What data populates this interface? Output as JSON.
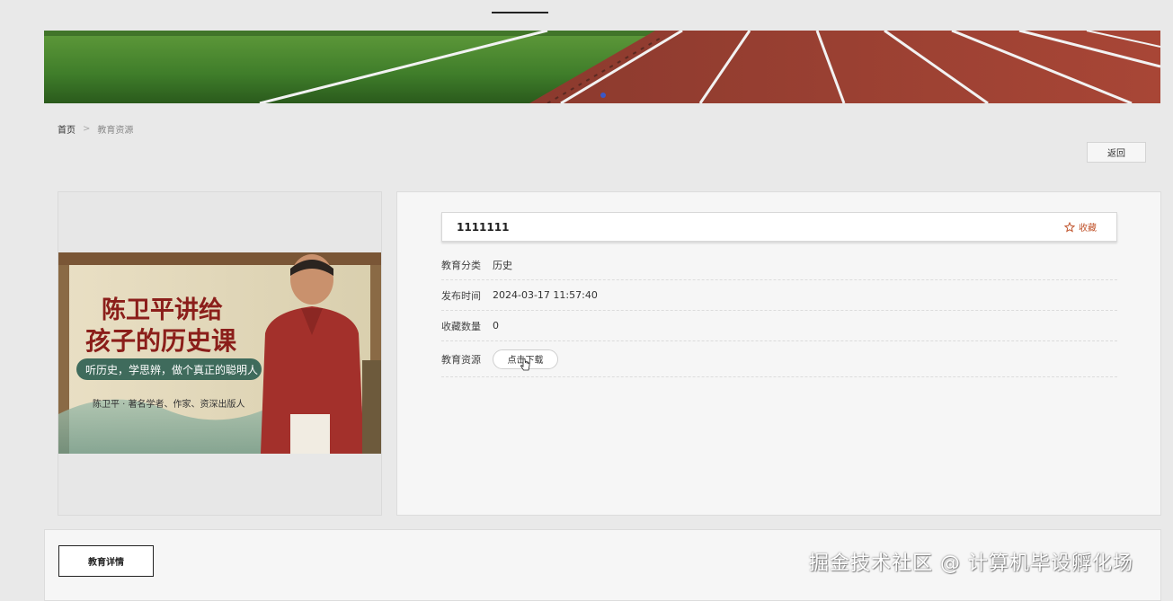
{
  "breadcrumb": {
    "home": "首页",
    "separator": ">",
    "current": "教育资源"
  },
  "actions": {
    "back_label": "返回"
  },
  "cover": {
    "title_line1": "陈卫平讲给",
    "title_line2": "孩子的历史课",
    "slogan": "听历史，学思辨，做个真正的聪明人",
    "author_line": "陈卫平 · 著名学者、作家、资深出版人"
  },
  "detail": {
    "title": "1111111",
    "favorite_label": "收藏",
    "fields": [
      {
        "label": "教育分类",
        "value": "历史"
      },
      {
        "label": "发布时间",
        "value": "2024-03-17 11:57:40"
      },
      {
        "label": "收藏数量",
        "value": "0"
      }
    ],
    "resource_label": "教育资源",
    "download_label": "点击下载"
  },
  "tabs": {
    "details_label": "教育详情"
  },
  "watermark": "掘金技术社区 @ 计算机毕设孵化场",
  "colors": {
    "accent": "#c0532b",
    "track": "#a84636",
    "grass": "#3f7d2a"
  }
}
